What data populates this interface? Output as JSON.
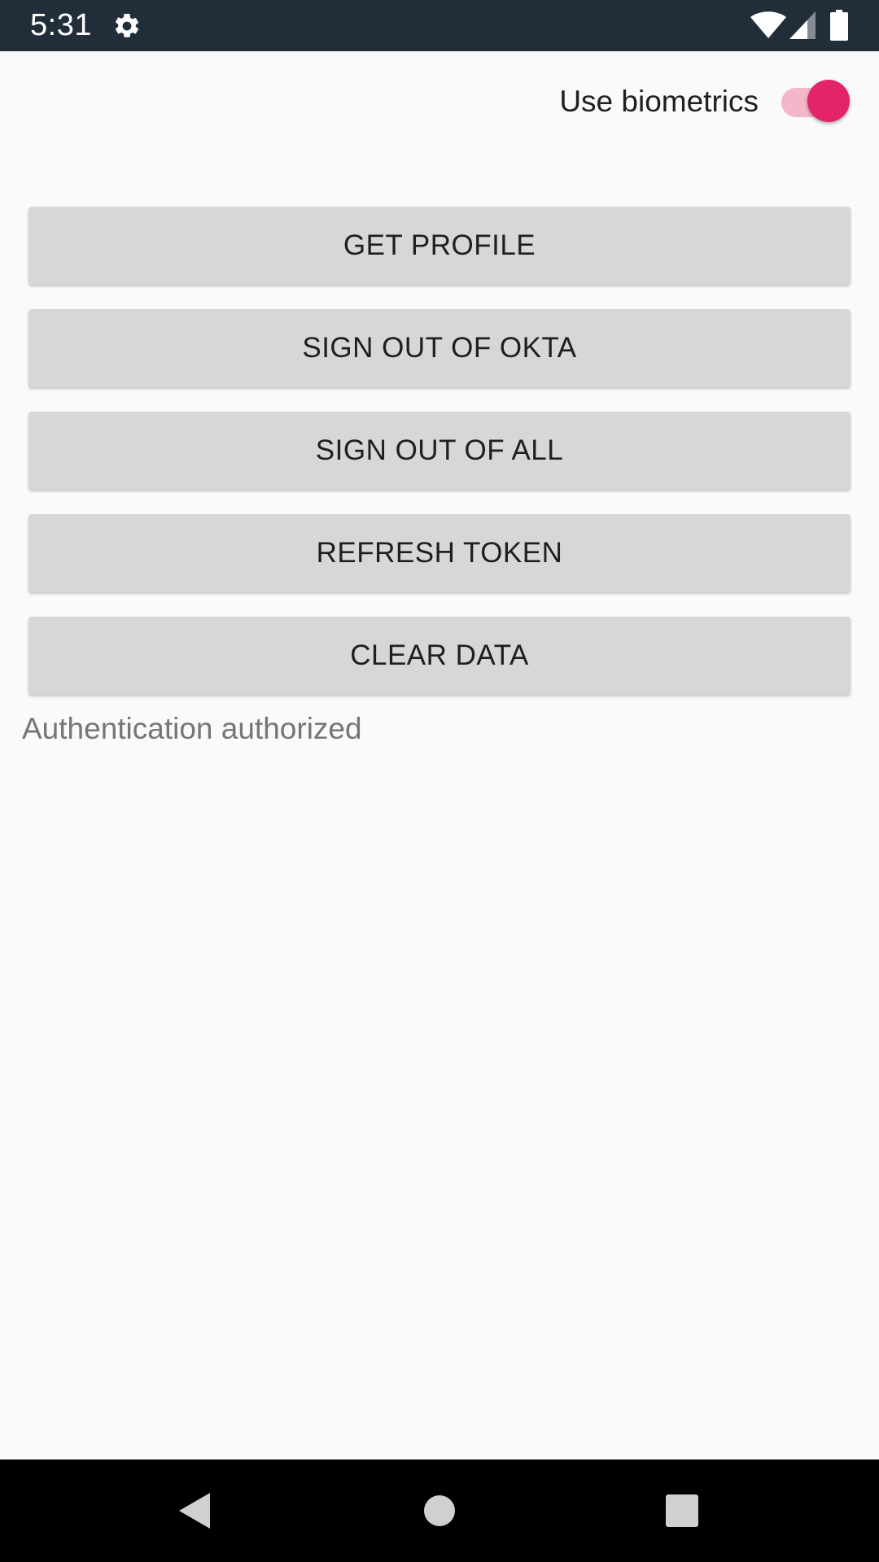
{
  "status_bar": {
    "time": "5:31",
    "icons": [
      "settings-gear-icon",
      "wifi-icon",
      "cellular-signal-icon",
      "battery-icon"
    ],
    "background": "#212e3a"
  },
  "biometrics": {
    "label": "Use biometrics",
    "enabled": true,
    "accent": "#e4246a"
  },
  "actions": {
    "get_profile": "GET PROFILE",
    "sign_out_okta": "SIGN OUT OF OKTA",
    "sign_out_all": "SIGN OUT OF ALL",
    "refresh_token": "REFRESH TOKEN",
    "clear_data": "CLEAR DATA"
  },
  "status_message": "Authentication authorized",
  "nav_bar": {
    "buttons": [
      "back-icon",
      "home-icon",
      "recents-icon"
    ]
  }
}
